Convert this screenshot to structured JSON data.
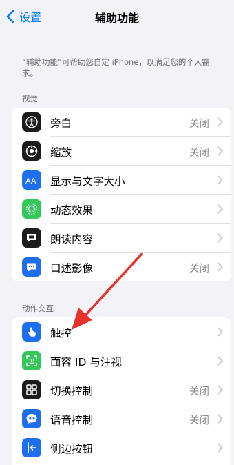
{
  "nav": {
    "back_label": "设置",
    "title": "辅助功能"
  },
  "intro": "“辅助功能”可帮助您自定 iPhone，以满足您的个人需求。",
  "sections": [
    {
      "header": "视觉",
      "items": [
        {
          "label": "旁白",
          "value": "关闭",
          "icon": "voiceover-icon",
          "color": "#1c1c1e"
        },
        {
          "label": "缩放",
          "value": "关闭",
          "icon": "zoom-icon",
          "color": "#1c1c1e"
        },
        {
          "label": "显示与文字大小",
          "value": "",
          "icon": "text-size-icon",
          "color": "#1e6ff0"
        },
        {
          "label": "动态效果",
          "value": "",
          "icon": "motion-icon",
          "color": "#34c759"
        },
        {
          "label": "朗读内容",
          "value": "",
          "icon": "spoken-content-icon",
          "color": "#1c1c1e"
        },
        {
          "label": "口述影像",
          "value": "关闭",
          "icon": "audio-description-icon",
          "color": "#1e6ff0"
        }
      ]
    },
    {
      "header": "动作交互",
      "items": [
        {
          "label": "触控",
          "value": "",
          "icon": "touch-icon",
          "color": "#1e6ff0"
        },
        {
          "label": "面容 ID 与注视",
          "value": "",
          "icon": "face-id-icon",
          "color": "#34c759"
        },
        {
          "label": "切换控制",
          "value": "关闭",
          "icon": "switch-control-icon",
          "color": "#1c1c1e"
        },
        {
          "label": "语音控制",
          "value": "关闭",
          "icon": "voice-control-icon",
          "color": "#1e6ff0"
        },
        {
          "label": "侧边按钮",
          "value": "",
          "icon": "side-button-icon",
          "color": "#1e6ff0"
        }
      ]
    }
  ],
  "annotation_color": "#e8322a"
}
